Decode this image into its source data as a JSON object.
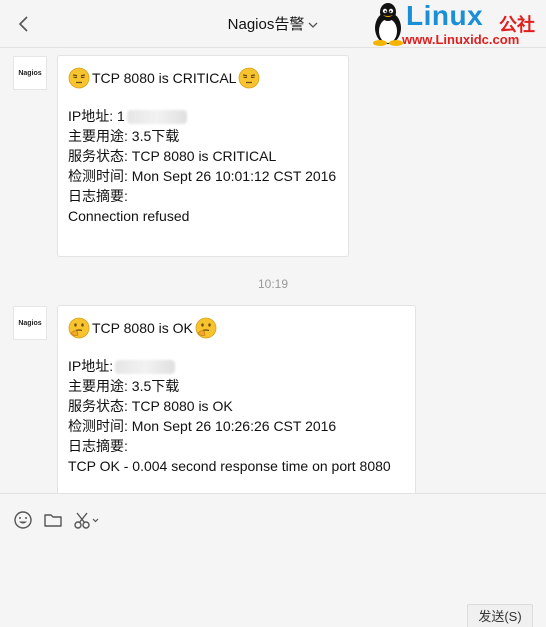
{
  "header": {
    "title": "Nagios告警"
  },
  "watermark": {
    "brand": "Linux",
    "brand_suffix": "公社",
    "url": "www.Linuxidc.com"
  },
  "messages": [
    {
      "avatar_text": "Nagios",
      "subject": "TCP 8080 is CRITICAL",
      "emoji": "disappointed-face-icon",
      "ip_label": "IP地址: 1",
      "lines": [
        "主要用途: 3.5下载",
        "服务状态: TCP 8080 is CRITICAL",
        "检测时间: Mon Sept 26 10:01:12 CST 2016",
        "日志摘要:",
        "Connection refused"
      ]
    },
    {
      "avatar_text": "Nagios",
      "subject": "TCP 8080 is OK",
      "emoji": "thinking-face-icon",
      "ip_label": "IP地址:",
      "lines": [
        "主要用途: 3.5下载",
        "服务状态: TCP 8080 is OK",
        "检测时间: Mon Sept 26 10:26:26 CST 2016",
        "日志摘要:",
        "TCP OK - 0.004 second response time on port 8080"
      ]
    }
  ],
  "time_separator": "10:19",
  "composer": {
    "send_label": "发送(S)"
  },
  "colors": {
    "background": "#f5f5f5",
    "bubble": "#ffffff",
    "brand_blue": "#1a8fd6",
    "brand_red": "#e21d1d",
    "emoji_yellow": "#f7c32e"
  }
}
